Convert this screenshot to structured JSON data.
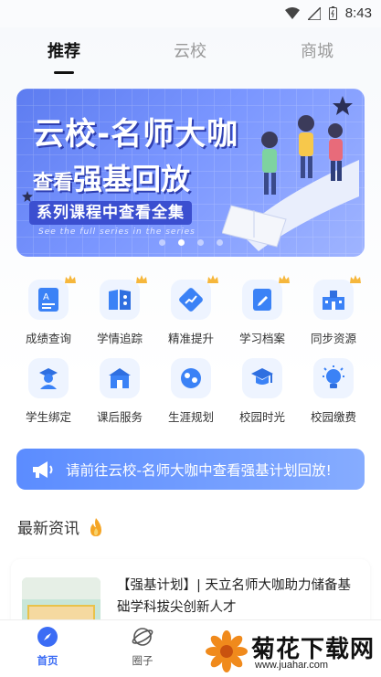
{
  "status_bar": {
    "time": "8:43"
  },
  "tabs": [
    {
      "label": "推荐",
      "active": true
    },
    {
      "label": "云校",
      "active": false
    },
    {
      "label": "商城",
      "active": false
    }
  ],
  "banner": {
    "title_line1": "云校-名师大咖",
    "title_line2_small": "查看",
    "title_line2_big": "强基回放",
    "pill": "系列课程中查看全集",
    "subtitle": "See the full series in the series",
    "dot_count": 4,
    "active_dot": 2
  },
  "grid_items": [
    {
      "label": "成绩查询",
      "icon": "score-report-icon",
      "crown": true
    },
    {
      "label": "学情追踪",
      "icon": "learning-track-icon",
      "crown": true
    },
    {
      "label": "精准提升",
      "icon": "precise-improve-icon",
      "crown": true
    },
    {
      "label": "学习档案",
      "icon": "study-archive-icon",
      "crown": true
    },
    {
      "label": "同步资源",
      "icon": "sync-resource-icon",
      "crown": true
    },
    {
      "label": "学生绑定",
      "icon": "student-bind-icon",
      "crown": false
    },
    {
      "label": "课后服务",
      "icon": "after-class-icon",
      "crown": false
    },
    {
      "label": "生涯规划",
      "icon": "career-plan-icon",
      "crown": false
    },
    {
      "label": "校园时光",
      "icon": "campus-time-icon",
      "crown": false
    },
    {
      "label": "校园缴费",
      "icon": "campus-pay-icon",
      "crown": false
    }
  ],
  "notice": {
    "text": "请前往云校-名师大咖中查看强基计划回放!",
    "icon": "megaphone-icon"
  },
  "section": {
    "title": "最新资讯",
    "icon": "fire-icon"
  },
  "news": [
    {
      "title": "【强基计划】| 天立名师大咖助力储备基础学科拔尖创新人才"
    }
  ],
  "bottom_nav": [
    {
      "label": "首页",
      "icon": "compass-icon",
      "active": true
    },
    {
      "label": "圈子",
      "icon": "planet-icon",
      "active": false
    }
  ],
  "watermark": {
    "title": "菊花下载网",
    "url": "www.juahar.com"
  },
  "colors": {
    "accent": "#3b6cf5",
    "banner": "#6f8cf8",
    "notice": "#6b98ff"
  }
}
